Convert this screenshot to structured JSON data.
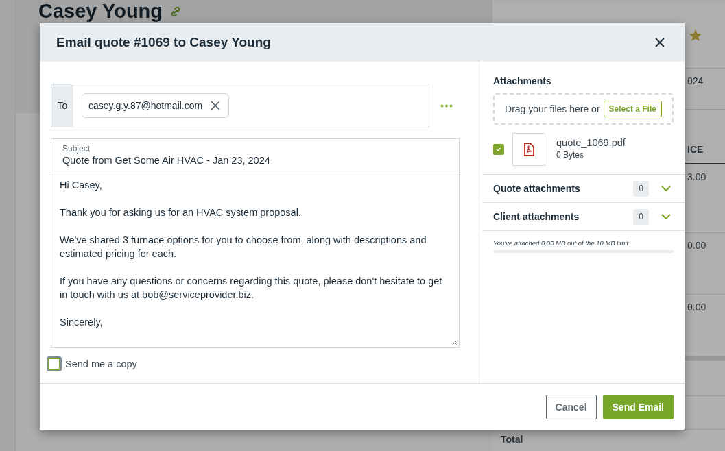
{
  "page": {
    "title": "Casey Young",
    "column_texts": [
      "024",
      "ICE",
      "3.00",
      "0.00",
      "0.00"
    ],
    "total_label": "Total"
  },
  "dialog": {
    "title": "Email quote #1069 to Casey Young",
    "to": {
      "label": "To",
      "recipients": [
        {
          "email": "casey.g.y.87@hotmail.com"
        }
      ]
    },
    "subject": {
      "label": "Subject",
      "value": "Quote from Get Some Air HVAC - Jan 23, 2024"
    },
    "body": [
      "Hi Casey,",
      "Thank you for asking us for an HVAC system proposal.",
      "We've shared 3 furnace options for you to choose from, along with descriptions and estimated pricing for each.",
      "If you have any questions or concerns regarding this quote, please don't hesitate to get in touch with us at bob@serviceprovider.biz.",
      "Sincerely,"
    ],
    "send_copy": {
      "label": "Send me a copy",
      "checked": false
    },
    "attachments": {
      "title": "Attachments",
      "drop_text": "Drag your files here or",
      "select_button": "Select a File",
      "files": [
        {
          "name": "quote_1069.pdf",
          "size": "0 Bytes",
          "checked": true
        }
      ],
      "sections": [
        {
          "label": "Quote attachments",
          "count": "0",
          "expanded": false
        },
        {
          "label": "Client attachments",
          "count": "0",
          "expanded": false
        }
      ],
      "limit_text": "You've attached 0.00 MB out of the 10 MB limit",
      "usage": {
        "level": 0
      }
    },
    "buttons": [
      {
        "label": "Cancel",
        "kind": "secondary"
      },
      {
        "label": "Send Email",
        "kind": "primary"
      }
    ]
  }
}
